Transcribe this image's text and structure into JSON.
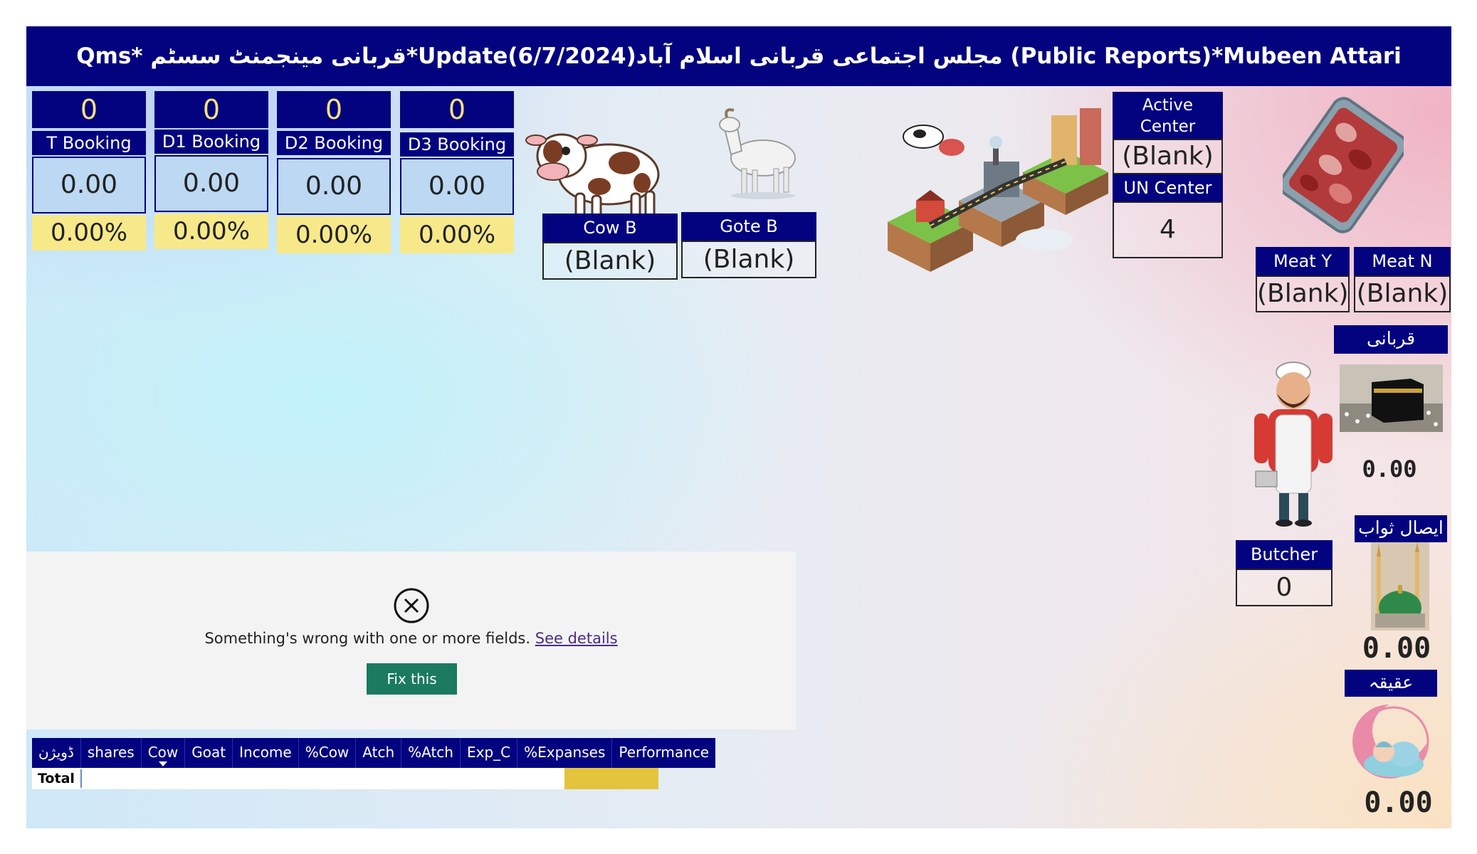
{
  "title": "Qms*  قربانی مینجمنٹ سسٹم*Update(6/7/2024)مجلس اجتماعی قربانی اسلام آباد (Public Reports)*Mubeen Attari",
  "colors": {
    "navy": "#03037f",
    "yellow": "#f7e98a",
    "fix_button": "#1b7a5f",
    "total_bar": "#e4c43c"
  },
  "kpis": [
    {
      "count": "0",
      "label": "T Booking",
      "value": "0.00",
      "pct": "0.00%"
    },
    {
      "count": "0",
      "label": "D1 Booking",
      "value": "0.00",
      "pct": "0.00%"
    },
    {
      "count": "0",
      "label": "D2 Booking",
      "value": "0.00",
      "pct": "0.00%"
    },
    {
      "count": "0",
      "label": "D3 Booking",
      "value": "0.00",
      "pct": "0.00%"
    }
  ],
  "animals": {
    "cow": {
      "label": "Cow B",
      "value": "(Blank)",
      "icon": "cow-icon"
    },
    "goat": {
      "label": "Gote B",
      "value": "(Blank)",
      "icon": "goat-icon"
    }
  },
  "centers": {
    "active_label": "Active Center",
    "active_value": "(Blank)",
    "un_label": "UN Center",
    "un_value": "4"
  },
  "meat": {
    "y_label": "Meat Y",
    "y_value": "(Blank)",
    "n_label": "Meat N",
    "n_value": "(Blank)",
    "icon": "meat-tray-icon"
  },
  "qurbani": {
    "label": "قربانی",
    "value": "0.00",
    "icon": "kaaba-icon"
  },
  "butcher": {
    "label": "Butcher",
    "value": "0",
    "icon": "butcher-icon"
  },
  "isal": {
    "label": "ایصال ثواب",
    "value": "0.00",
    "icon": "green-dome-icon"
  },
  "aqiqa": {
    "label": "عقیقہ",
    "value": "0.00",
    "icon": "baby-moon-icon"
  },
  "error_panel": {
    "icon": "close-circle-icon",
    "message": "Something's wrong with one or more fields.",
    "link": "See details",
    "button": "Fix this"
  },
  "table": {
    "columns": [
      "ڈویژن",
      "shares",
      "Cow",
      "Goat",
      "Income",
      "%Cow",
      "Atch",
      "%Atch",
      "Exp_C",
      "%Expanses",
      "Performance"
    ],
    "sorted_column": "Cow",
    "total_label": "Total"
  }
}
